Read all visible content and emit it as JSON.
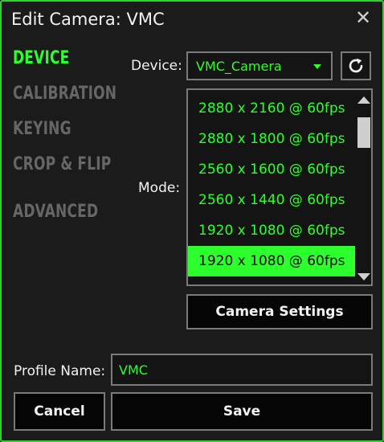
{
  "window": {
    "title": "Edit Camera: VMC",
    "close_glyph": "✕"
  },
  "nav": {
    "items": [
      {
        "label": "DEVICE",
        "active": true
      },
      {
        "label": "CALIBRATION",
        "active": false
      },
      {
        "label": "KEYING",
        "active": false
      },
      {
        "label": "CROP & FLIP",
        "active": false
      },
      {
        "label": "ADVANCED",
        "active": false
      }
    ]
  },
  "device": {
    "label": "Device:",
    "selected": "VMC_Camera",
    "refresh_icon": "refresh-icon"
  },
  "mode": {
    "label": "Mode:",
    "options": [
      "2880 x 2160 @ 60fps",
      "2880 x 1800 @ 60fps",
      "2560 x 1600 @ 60fps",
      "2560 x 1440 @ 60fps",
      "1920 x 1080 @ 60fps",
      "1920 x 1080 @ 60fps"
    ],
    "selected_index": 5
  },
  "camera_settings": {
    "label": "Camera Settings"
  },
  "profile": {
    "label": "Profile Name:",
    "value": "VMC"
  },
  "footer": {
    "cancel_label": "Cancel",
    "save_label": "Save"
  },
  "colors": {
    "accent": "#2cff2c",
    "border": "#2fd12f",
    "inactive_nav": "#666666",
    "background": "#1b1b1b"
  }
}
